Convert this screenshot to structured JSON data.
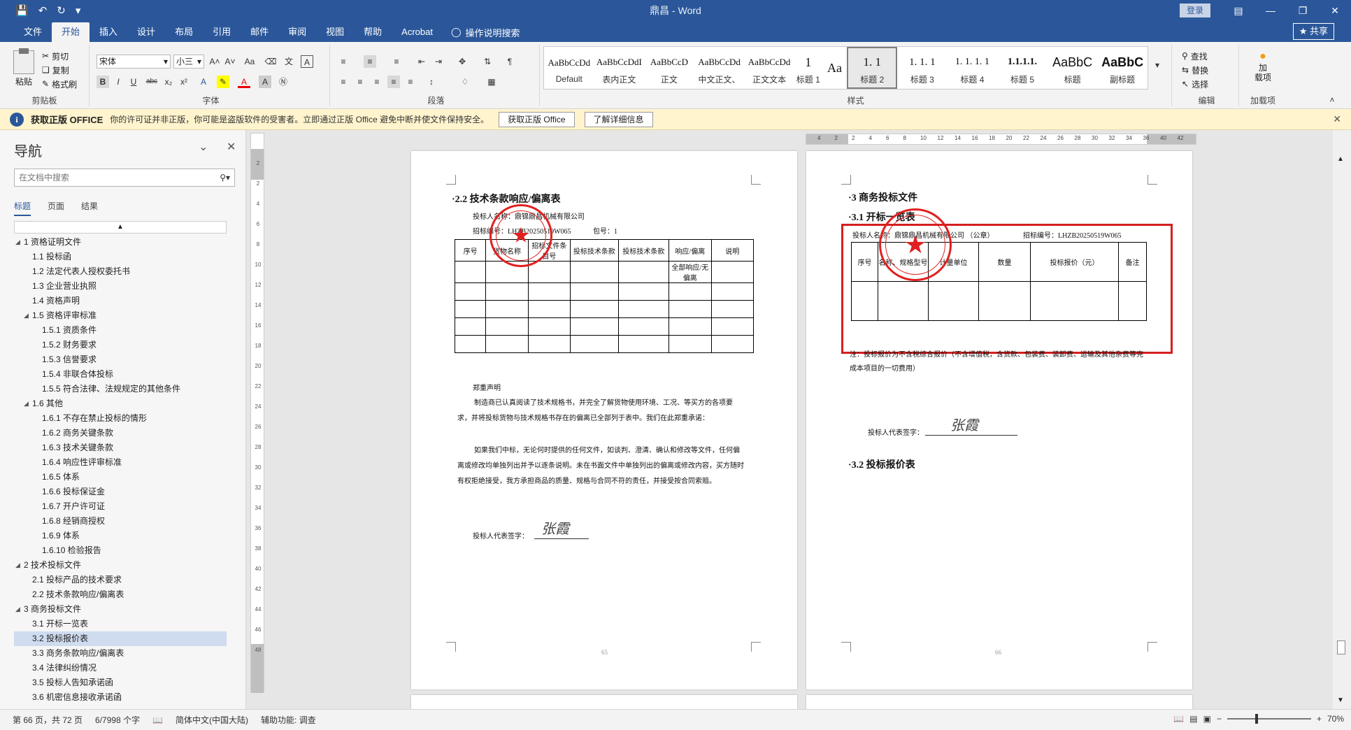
{
  "app": {
    "doc_title": "鼎昌 - Word",
    "login_label": "登录",
    "share_label": "共享"
  },
  "tabs": [
    "文件",
    "开始",
    "插入",
    "设计",
    "布局",
    "引用",
    "邮件",
    "审阅",
    "视图",
    "帮助",
    "Acrobat"
  ],
  "active_tab": "开始",
  "tellme": "操作说明搜索",
  "ribbon": {
    "clipboard": {
      "paste": "粘贴",
      "cut": "剪切",
      "copy": "复制",
      "painter": "格式刷",
      "label": "剪贴板"
    },
    "font": {
      "name": "宋体",
      "size": "小三",
      "label": "字体"
    },
    "paragraph": {
      "label": "段落"
    },
    "styles": {
      "label": "样式",
      "items": [
        {
          "sample": "AaBbCcDd",
          "name": "Default"
        },
        {
          "sample": "AaBbCcDdI",
          "name": "表内正文"
        },
        {
          "sample": "AaBbCcD",
          "name": "正文"
        },
        {
          "sample": "AaBbCcDd",
          "name": "中文正文、"
        },
        {
          "sample": "AaBbCcDd",
          "name": "正文文本"
        },
        {
          "sample": "1",
          "name": "标题 1"
        },
        {
          "sample": "Aa",
          "name": ""
        },
        {
          "sample": "1. 1",
          "name": "标题 2"
        },
        {
          "sample": "1. 1. 1",
          "name": "标题 3"
        },
        {
          "sample": "1. 1. 1. 1",
          "name": "标题 4"
        },
        {
          "sample": "1.1.1.1.",
          "name": "标题 5"
        },
        {
          "sample": "AaBbC",
          "name": "标题"
        },
        {
          "sample": "AaBbC",
          "name": "副标题"
        }
      ],
      "selected_index": 7
    },
    "editing": {
      "find": "查找",
      "replace": "替换",
      "select": "选择",
      "label": "编辑"
    },
    "addins": {
      "addin": "加\n载项",
      "label": "加载项"
    }
  },
  "message_bar": {
    "title": "获取正版 OFFICE",
    "text": "你的许可证并非正版，你可能是盗版软件的受害者。立即通过正版 Office 避免中断并使文件保持安全。",
    "btn1": "获取正版 Office",
    "btn2": "了解详细信息"
  },
  "nav": {
    "title": "导航",
    "search_placeholder": "在文档中搜索",
    "tabs": [
      "标题",
      "页面",
      "结果"
    ],
    "items": [
      {
        "text": "1 资格证明文件",
        "level": 0,
        "caret": "◢"
      },
      {
        "text": "1.1 投标函",
        "level": 1
      },
      {
        "text": "1.2 法定代表人授权委托书",
        "level": 1
      },
      {
        "text": "1.3 企业营业执照",
        "level": 1
      },
      {
        "text": "1.4 资格声明",
        "level": 1
      },
      {
        "text": "1.5 资格评审标准",
        "level": 1,
        "caret": "◢"
      },
      {
        "text": "1.5.1 资质条件",
        "level": 2
      },
      {
        "text": "1.5.2 财务要求",
        "level": 2
      },
      {
        "text": "1.5.3 信誉要求",
        "level": 2
      },
      {
        "text": "1.5.4 非联合体投标",
        "level": 2
      },
      {
        "text": "1.5.5 符合法律、法规规定的其他条件",
        "level": 2
      },
      {
        "text": "1.6 其他",
        "level": 1,
        "caret": "◢"
      },
      {
        "text": "1.6.1 不存在禁止投标的情形",
        "level": 2
      },
      {
        "text": "1.6.2 商务关键条款",
        "level": 2
      },
      {
        "text": "1.6.3 技术关键条款",
        "level": 2
      },
      {
        "text": "1.6.4 响应性评审标准",
        "level": 2
      },
      {
        "text": "1.6.5 体系",
        "level": 2
      },
      {
        "text": "1.6.6 投标保证金",
        "level": 2
      },
      {
        "text": "1.6.7 开户许可证",
        "level": 2
      },
      {
        "text": "1.6.8 经销商授权",
        "level": 2
      },
      {
        "text": "1.6.9 体系",
        "level": 2
      },
      {
        "text": "1.6.10 检验报告",
        "level": 2
      },
      {
        "text": "2 技术投标文件",
        "level": 0,
        "caret": "◢"
      },
      {
        "text": "2.1 投标产品的技术要求",
        "level": 1
      },
      {
        "text": "2.2 技术条款响应/偏离表",
        "level": 1
      },
      {
        "text": "3 商务投标文件",
        "level": 0,
        "caret": "◢"
      },
      {
        "text": "3.1 开标一览表",
        "level": 1
      },
      {
        "text": "3.2 投标报价表",
        "level": 1,
        "selected": true
      },
      {
        "text": "3.3 商务条款响应/偏离表",
        "level": 1
      },
      {
        "text": "3.4 法律纠纷情况",
        "level": 1
      },
      {
        "text": "3.5 投标人告知承诺函",
        "level": 1
      },
      {
        "text": "3.6 机密信息接收承诺函",
        "level": 1
      }
    ]
  },
  "vruler_ticks": [
    "2",
    "2",
    "4",
    "6",
    "8",
    "10",
    "12",
    "14",
    "16",
    "18",
    "20",
    "22",
    "24",
    "26",
    "28",
    "30",
    "32",
    "34",
    "36",
    "38",
    "40",
    "42",
    "44",
    "46",
    "48"
  ],
  "hruler_ticks": [
    "4",
    "2",
    "2",
    "4",
    "6",
    "8",
    "10",
    "12",
    "14",
    "16",
    "18",
    "20",
    "22",
    "24",
    "26",
    "28",
    "30",
    "32",
    "34",
    "36",
    "40",
    "42"
  ],
  "page_left": {
    "heading": "·2.2 技术条款响应/偏离表",
    "bidder": "投标人名称：鼎锦鼎昌机械有限公司",
    "bid_no": "招标编号：LHZB20250519W065",
    "pkg": "包号：1",
    "table_headers": [
      "序号",
      "货物名称",
      "招标文件条目号",
      "投标技术条款",
      "投标技术条款",
      "响应/偏离",
      "说明"
    ],
    "table_sub": "全部响应/无偏离",
    "statement_title": "郑重声明",
    "statement_p1": "制造商已认真阅读了技术规格书，并完全了解货物使用环境、工况、等买方的各项要求，并将投标货物与技术规格书存在的偏离已全部列于表中。我们在此郑重承诺：",
    "statement_p2": "如果我们中标，无论何时提供的任何文件，如谈判、澄清、确认和修改等文件，任何偏离或修改均单独列出并予以逐条说明。未在书面文件中单独列出的偏离或修改内容，买方随时有权拒绝接受，我方承担商品的质量、规格与合同不符的责任，并接受按合同索赔。",
    "sign_label": "投标人代表签字：",
    "signature": "张霞",
    "page_no": "65"
  },
  "page_right": {
    "heading1": "·3  商务投标文件",
    "heading2": "·3.1 开标一览表",
    "bidder": "投标人名称：鼎锦鼎昌机械有限公司 （公章）",
    "bid_no": "招标编号：LHZB20250519W065",
    "table_headers": [
      "序号",
      "名称、规格型号",
      "计量单位",
      "数量",
      "投标报价（元）",
      "备注"
    ],
    "note": "注：投标报价为不含税综合报价（不含增值税，含货款、包装费、装卸费、运输及其他杂费等完成本项目的一切费用）",
    "sign_label": "投标人代表签字：",
    "signature": "张霞",
    "heading3": "·3.2 投标报价表",
    "page_no": "66"
  },
  "status": {
    "page": "第 66 页，共 72 页",
    "words": "6/7998 个字",
    "lang": "简体中文(中国大陆)",
    "access": "辅助功能: 调查",
    "zoom": "70%"
  },
  "colors": {
    "brand": "#2b579a",
    "seal": "#e02020",
    "highlight": "#d61f1f"
  }
}
